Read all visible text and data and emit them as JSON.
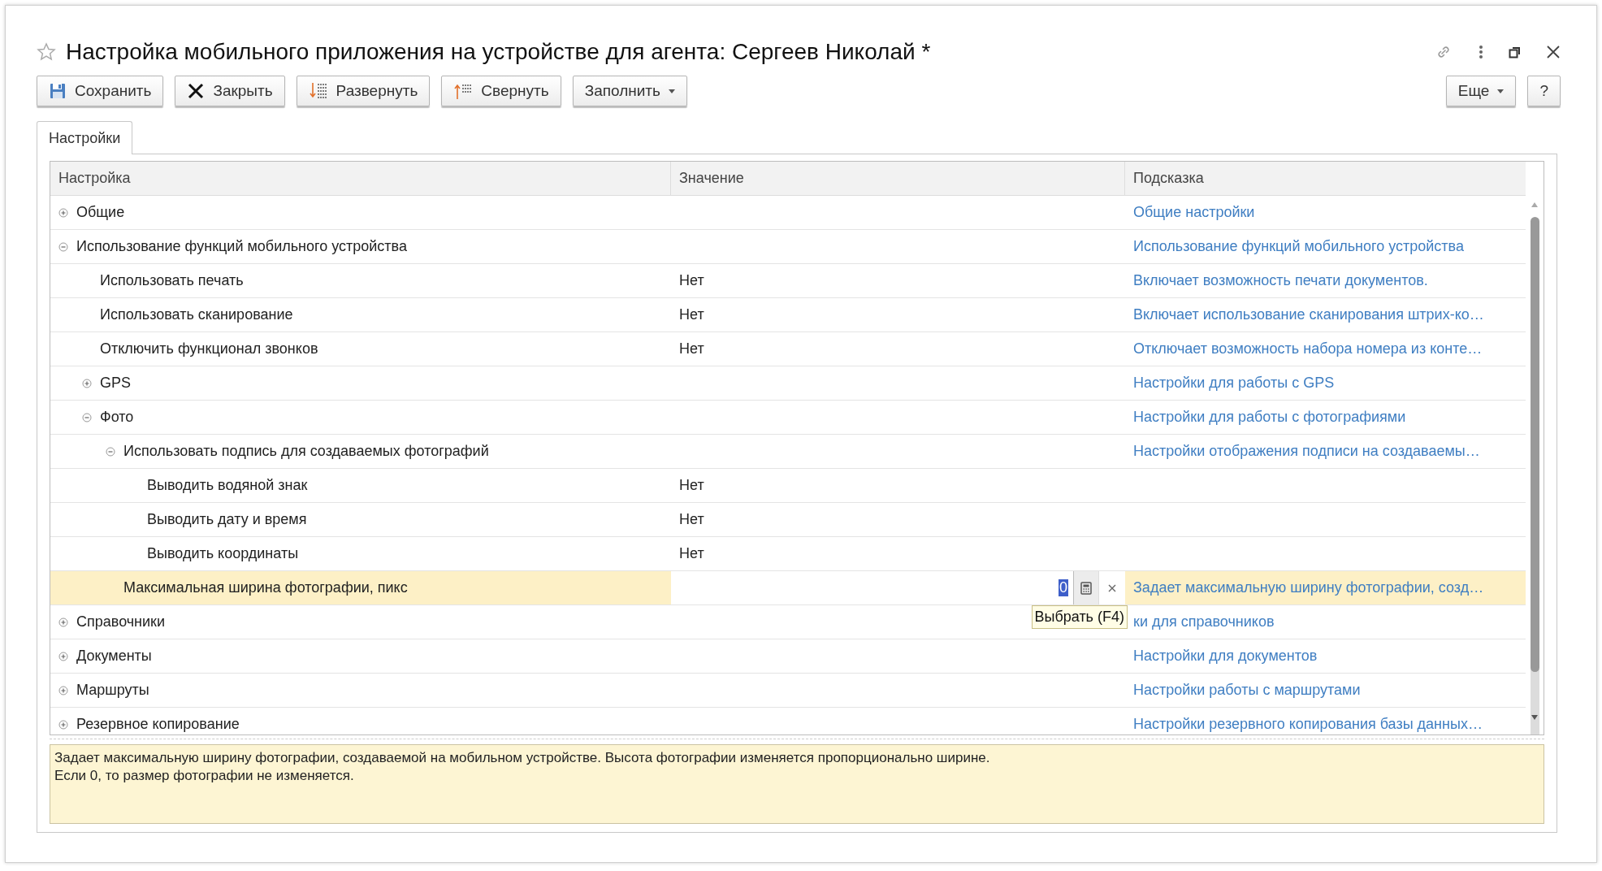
{
  "window": {
    "title": "Настройка мобильного приложения на устройстве для агента: Сергеев Николай *"
  },
  "toolbar": {
    "buttons": [
      {
        "label": "Сохранить"
      },
      {
        "label": "Закрыть"
      },
      {
        "label": "Развернуть"
      },
      {
        "label": "Свернуть"
      },
      {
        "label": "Заполнить",
        "dropdown": true
      }
    ],
    "right_buttons": [
      {
        "label": "Еще",
        "dropdown": true
      },
      {
        "label": "?"
      }
    ]
  },
  "tabs": [
    {
      "label": "Настройки",
      "selected": true
    }
  ],
  "table": {
    "columns": [
      "Настройка",
      "Значение",
      "Подсказка"
    ],
    "rows": [
      {
        "label": "Общие",
        "expanded": false,
        "selected": false,
        "hint": "Общие настройки"
      },
      {
        "label": "Использование функций мобильного устройства",
        "expanded": true,
        "selected": false,
        "hint": "Использование функций мобильного устройства",
        "children": [
          {
            "label": "Использовать печать",
            "value": "Нет",
            "selected": false,
            "hint": "Включает возможность печати документов."
          },
          {
            "label": "Использовать сканирование",
            "value": "Нет",
            "selected": false,
            "hint": "Включает использование сканирования штрих-ко…"
          },
          {
            "label": "Отключить функционал звонков",
            "value": "Нет",
            "selected": false,
            "hint": "Отключает возможность набора номера из конте…"
          },
          {
            "label": "GPS",
            "expanded": false,
            "selected": false,
            "hint": "Настройки для работы с GPS"
          },
          {
            "label": "Фото",
            "expanded": true,
            "selected": false,
            "hint": "Настройки для работы с фотографиями",
            "children": [
              {
                "label": "Использовать подпись для создаваемых фотографий",
                "expanded": true,
                "selected": false,
                "hint": "Настройки отображения подписи на создаваемы…",
                "children": [
                  {
                    "label": "Выводить водяной знак",
                    "value": "Нет",
                    "selected": false
                  },
                  {
                    "label": "Выводить дату и время",
                    "value": "Нет",
                    "selected": false
                  },
                  {
                    "label": "Выводить координаты",
                    "value": "Нет",
                    "selected": false
                  }
                ]
              },
              {
                "label": "Максимальная ширина фотографии, пикс",
                "selected": true,
                "editor": {
                  "value": "0"
                },
                "hint": "Задает максимальную ширину фотографии, созд…"
              }
            ]
          }
        ]
      },
      {
        "label": "Справочники",
        "expanded": false,
        "selected": false,
        "hint": "ки для справочников"
      },
      {
        "label": "Документы",
        "expanded": false,
        "selected": false,
        "hint": "Настройки для документов"
      },
      {
        "label": "Маршруты",
        "expanded": false,
        "selected": false,
        "hint": "Настройки работы с маршрутами"
      },
      {
        "label": "Резервное копирование",
        "expanded": false,
        "selected": false,
        "hint": "Настройки резервного копирования базы данных…"
      }
    ]
  },
  "tooltip": "Выбрать (F4)",
  "description": "Задает максимальную ширину фотографии, создаваемой на мобильном устройстве. Высота фотографии изменяется пропорционально ширине.\nЕсли 0, то размер фотографии не изменяется."
}
